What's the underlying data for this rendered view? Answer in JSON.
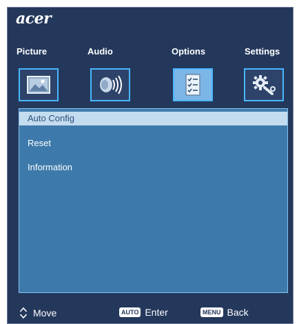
{
  "brand": {
    "logo_text": "acer"
  },
  "tabs": [
    {
      "label": "Picture",
      "icon": "picture-icon"
    },
    {
      "label": "Audio",
      "icon": "audio-icon"
    },
    {
      "label": "Options",
      "icon": "options-icon",
      "active": true
    },
    {
      "label": "Settings",
      "icon": "settings-icon"
    }
  ],
  "menu": {
    "items": [
      {
        "label": "Auto Config",
        "selected": true
      },
      {
        "label": "Reset",
        "selected": false
      },
      {
        "label": "Information",
        "selected": false
      }
    ]
  },
  "footer": {
    "move_label": "Move",
    "enter_key": "AUTO",
    "enter_label": "Enter",
    "back_key": "MENU",
    "back_label": "Back"
  },
  "colors": {
    "osd_background": "#24385c",
    "panel_background": "#3d7aab",
    "selected_row": "#c4dcef",
    "icon_border": "#49b8ff",
    "active_icon_fill": "#7cb6e6"
  }
}
